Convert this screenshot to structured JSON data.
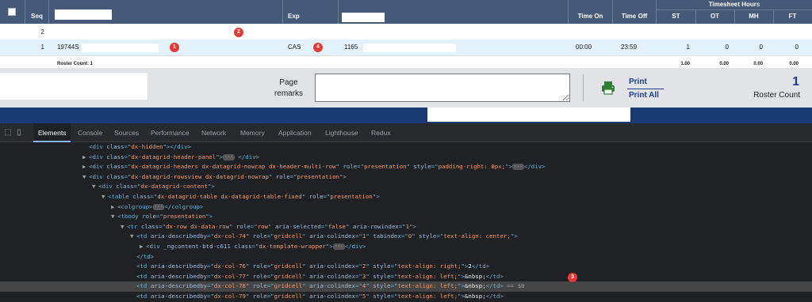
{
  "grid": {
    "headers": {
      "seq": "Seq",
      "exp": "Exp",
      "time_on": "Time On",
      "time_off": "Time Off",
      "timesheet_hours": "Timesheet Hours",
      "st": "ST",
      "ot": "OT",
      "mh": "MH",
      "ft": "FT"
    },
    "rows": [
      {
        "seq": "2",
        "name": "",
        "exp": "",
        "num": "",
        "time_on": "",
        "time_off": "",
        "st": "",
        "ot": "",
        "mh": "",
        "ft": "",
        "marker": "2"
      },
      {
        "seq": "1",
        "name": "19744S",
        "exp": "CAS",
        "num": "1165",
        "time_on": "00:00",
        "time_off": "23:59",
        "st": "1",
        "ot": "0",
        "mh": "0",
        "ft": "0",
        "marker_name": "1",
        "marker_exp": "4"
      }
    ],
    "summary": {
      "roster_count_label": "Roster Count: 1",
      "st_total": "1.00",
      "ot_total": "0.00",
      "mh_total": "0.00",
      "ft_total": "0.00"
    }
  },
  "footer": {
    "page_remarks_line1": "Page",
    "page_remarks_line2": "remarks",
    "print_label": "Print",
    "print_all_label": "Print All",
    "roster_count_value": "1",
    "roster_count_label": "Roster Count"
  },
  "devtools": {
    "tabs": [
      "Elements",
      "Console",
      "Sources",
      "Performance",
      "Network",
      "Memory",
      "Application",
      "Lighthouse",
      "Redux"
    ],
    "active_tab": "Elements",
    "marker": "3",
    "lines": [
      {
        "indent": 0,
        "arrow": "",
        "parts": [
          [
            "tg",
            "<div "
          ],
          [
            "an",
            "class"
          ],
          [
            "tg",
            "=\""
          ],
          [
            "av",
            "dx-hidden"
          ],
          [
            "tg",
            "\"></div>"
          ]
        ]
      },
      {
        "indent": 0,
        "arrow": "▶",
        "parts": [
          [
            "tg",
            "<div "
          ],
          [
            "an",
            "class"
          ],
          [
            "tg",
            "=\""
          ],
          [
            "av",
            "dx-datagrid-header-panel"
          ],
          [
            "tg",
            "\">"
          ],
          [
            "ell",
            "···"
          ],
          [
            "tg",
            " </div>"
          ]
        ]
      },
      {
        "indent": 0,
        "arrow": "▶",
        "parts": [
          [
            "tg",
            "<div "
          ],
          [
            "an",
            "class"
          ],
          [
            "tg",
            "=\""
          ],
          [
            "av",
            "dx-datagrid-headers dx-datagrid-nowrap dx-header-multi-row"
          ],
          [
            "tg",
            "\" "
          ],
          [
            "an",
            "role"
          ],
          [
            "tg",
            "=\""
          ],
          [
            "av",
            "presentation"
          ],
          [
            "tg",
            "\" "
          ],
          [
            "an",
            "style"
          ],
          [
            "tg",
            "=\""
          ],
          [
            "av",
            "padding-right: 0px;"
          ],
          [
            "tg",
            "\">"
          ],
          [
            "ell",
            "···"
          ],
          [
            "tg",
            "</div>"
          ]
        ]
      },
      {
        "indent": 0,
        "arrow": "▼",
        "parts": [
          [
            "tg",
            "<div "
          ],
          [
            "an",
            "class"
          ],
          [
            "tg",
            "=\""
          ],
          [
            "av",
            "dx-datagrid-rowsview dx-datagrid-nowrap"
          ],
          [
            "tg",
            "\" "
          ],
          [
            "an",
            "role"
          ],
          [
            "tg",
            "=\""
          ],
          [
            "av",
            "presentation"
          ],
          [
            "tg",
            "\">"
          ]
        ]
      },
      {
        "indent": 1,
        "arrow": "▼",
        "parts": [
          [
            "tg",
            "<div "
          ],
          [
            "an",
            "class"
          ],
          [
            "tg",
            "=\""
          ],
          [
            "av",
            "dx-datagrid-content"
          ],
          [
            "tg",
            "\">"
          ]
        ]
      },
      {
        "indent": 2,
        "arrow": "▼",
        "parts": [
          [
            "tg",
            "<table "
          ],
          [
            "an",
            "class"
          ],
          [
            "tg",
            "=\""
          ],
          [
            "av",
            "dx-datagrid-table dx-datagrid-table-fixed"
          ],
          [
            "tg",
            "\" "
          ],
          [
            "an",
            "role"
          ],
          [
            "tg",
            "=\""
          ],
          [
            "av",
            "presentation"
          ],
          [
            "tg",
            "\">"
          ]
        ]
      },
      {
        "indent": 3,
        "arrow": "▶",
        "parts": [
          [
            "tg",
            "<colgroup>"
          ],
          [
            "ell",
            "···"
          ],
          [
            "tg",
            "</colgroup>"
          ]
        ]
      },
      {
        "indent": 3,
        "arrow": "▼",
        "parts": [
          [
            "tg",
            "<tbody "
          ],
          [
            "an",
            "role"
          ],
          [
            "tg",
            "=\""
          ],
          [
            "av",
            "presentation"
          ],
          [
            "tg",
            "\">"
          ]
        ]
      },
      {
        "indent": 4,
        "arrow": "▼",
        "parts": [
          [
            "tg",
            "<tr "
          ],
          [
            "an",
            "class"
          ],
          [
            "tg",
            "=\""
          ],
          [
            "av",
            "dx-row dx-data-row"
          ],
          [
            "tg",
            "\" "
          ],
          [
            "an",
            "role"
          ],
          [
            "tg",
            "=\""
          ],
          [
            "av",
            "row"
          ],
          [
            "tg",
            "\" "
          ],
          [
            "an",
            "aria-selected"
          ],
          [
            "tg",
            "=\""
          ],
          [
            "av",
            "false"
          ],
          [
            "tg",
            "\" "
          ],
          [
            "an",
            "aria-rowindex"
          ],
          [
            "tg",
            "=\""
          ],
          [
            "av",
            "1"
          ],
          [
            "tg",
            "\">"
          ]
        ]
      },
      {
        "indent": 5,
        "arrow": "▼",
        "parts": [
          [
            "tg",
            "<td "
          ],
          [
            "an",
            "aria-describedby"
          ],
          [
            "tg",
            "=\""
          ],
          [
            "av",
            "dx-col-74"
          ],
          [
            "tg",
            "\" "
          ],
          [
            "an",
            "role"
          ],
          [
            "tg",
            "=\""
          ],
          [
            "av",
            "gridcell"
          ],
          [
            "tg",
            "\" "
          ],
          [
            "an",
            "aria-colindex"
          ],
          [
            "tg",
            "=\""
          ],
          [
            "av",
            "1"
          ],
          [
            "tg",
            "\" "
          ],
          [
            "an",
            "tabindex"
          ],
          [
            "tg",
            "=\""
          ],
          [
            "av",
            "0"
          ],
          [
            "tg",
            "\" "
          ],
          [
            "an",
            "style"
          ],
          [
            "tg",
            "=\""
          ],
          [
            "av",
            "text-align: center;"
          ],
          [
            "tg",
            "\">"
          ]
        ]
      },
      {
        "indent": 6,
        "arrow": "▶",
        "parts": [
          [
            "tg",
            "<div "
          ],
          [
            "an",
            "_ngcontent-btd-c611"
          ],
          [
            "tg",
            " "
          ],
          [
            "an",
            "class"
          ],
          [
            "tg",
            "=\""
          ],
          [
            "av",
            "dx-template-wrapper"
          ],
          [
            "tg",
            "\">"
          ],
          [
            "ell",
            "···"
          ],
          [
            "tg",
            "</div>"
          ]
        ]
      },
      {
        "indent": 5,
        "arrow": "",
        "parts": [
          [
            "tg",
            "</td>"
          ]
        ]
      },
      {
        "indent": 5,
        "arrow": "",
        "parts": [
          [
            "tg",
            "<td "
          ],
          [
            "an",
            "aria-describedby"
          ],
          [
            "tg",
            "=\""
          ],
          [
            "av",
            "dx-col-76"
          ],
          [
            "tg",
            "\" "
          ],
          [
            "an",
            "role"
          ],
          [
            "tg",
            "=\""
          ],
          [
            "av",
            "gridcell"
          ],
          [
            "tg",
            "\" "
          ],
          [
            "an",
            "aria-colindex"
          ],
          [
            "tg",
            "=\""
          ],
          [
            "av",
            "2"
          ],
          [
            "tg",
            "\" "
          ],
          [
            "an",
            "style"
          ],
          [
            "tg",
            "=\""
          ],
          [
            "av",
            "text-align: right;"
          ],
          [
            "tg",
            "\">"
          ],
          [
            "tx",
            "2"
          ],
          [
            "tg",
            "</td>"
          ]
        ]
      },
      {
        "indent": 5,
        "arrow": "",
        "parts": [
          [
            "tg",
            "<td "
          ],
          [
            "an",
            "aria-describedby"
          ],
          [
            "tg",
            "=\""
          ],
          [
            "av",
            "dx-col-77"
          ],
          [
            "tg",
            "\" "
          ],
          [
            "an",
            "role"
          ],
          [
            "tg",
            "=\""
          ],
          [
            "av",
            "gridcell"
          ],
          [
            "tg",
            "\" "
          ],
          [
            "an",
            "aria-colindex"
          ],
          [
            "tg",
            "=\""
          ],
          [
            "av",
            "3"
          ],
          [
            "tg",
            "\" "
          ],
          [
            "an",
            "style"
          ],
          [
            "tg",
            "=\""
          ],
          [
            "av",
            "text-align: left;"
          ],
          [
            "tg",
            "\">"
          ],
          [
            "tx",
            "&nbsp;"
          ],
          [
            "tg",
            "</td>"
          ]
        ]
      },
      {
        "indent": 5,
        "arrow": "",
        "selected": true,
        "parts": [
          [
            "tg",
            "<td "
          ],
          [
            "an",
            "aria-describedby"
          ],
          [
            "tg",
            "=\""
          ],
          [
            "av",
            "dx-col-78"
          ],
          [
            "tg",
            "\" "
          ],
          [
            "an",
            "role"
          ],
          [
            "tg",
            "=\""
          ],
          [
            "av",
            "gridcell"
          ],
          [
            "tg",
            "\" "
          ],
          [
            "an",
            "aria-colindex"
          ],
          [
            "tg",
            "=\""
          ],
          [
            "av",
            "4"
          ],
          [
            "tg",
            "\" "
          ],
          [
            "an",
            "style"
          ],
          [
            "tg",
            "=\""
          ],
          [
            "av",
            "text-align: left;"
          ],
          [
            "tg",
            "\">"
          ],
          [
            "tx",
            "&nbsp;"
          ],
          [
            "tg",
            "</td>"
          ],
          [
            "eq",
            " == $0"
          ]
        ]
      },
      {
        "indent": 5,
        "arrow": "",
        "parts": [
          [
            "tg",
            "<td "
          ],
          [
            "an",
            "aria-describedby"
          ],
          [
            "tg",
            "=\""
          ],
          [
            "av",
            "dx-col-79"
          ],
          [
            "tg",
            "\" "
          ],
          [
            "an",
            "role"
          ],
          [
            "tg",
            "=\""
          ],
          [
            "av",
            "gridcell"
          ],
          [
            "tg",
            "\" "
          ],
          [
            "an",
            "aria-colindex"
          ],
          [
            "tg",
            "=\""
          ],
          [
            "av",
            "5"
          ],
          [
            "tg",
            "\" "
          ],
          [
            "an",
            "style"
          ],
          [
            "tg",
            "=\""
          ],
          [
            "av",
            "text-align: left;"
          ],
          [
            "tg",
            "\">"
          ],
          [
            "tx",
            "&nbsp;"
          ],
          [
            "tg",
            "</td>"
          ]
        ]
      },
      {
        "indent": 5,
        "arrow": "",
        "parts": [
          [
            "tg",
            "<td "
          ],
          [
            "an",
            "aria-describedby"
          ],
          [
            "tg",
            "=\""
          ],
          [
            "av",
            "dx-col-81"
          ],
          [
            "tg",
            "\" "
          ],
          [
            "an",
            "role"
          ],
          [
            "tg",
            "=\""
          ],
          [
            "av",
            "gridcell"
          ],
          [
            "tg",
            "\" "
          ],
          [
            "an",
            "aria-colindex"
          ],
          [
            "tg",
            "=\""
          ],
          [
            "av",
            "6"
          ],
          [
            "tg",
            "\" "
          ],
          [
            "an",
            "style"
          ],
          [
            "tg",
            "=\""
          ],
          [
            "av",
            "text-align: left;"
          ],
          [
            "tg",
            "\">"
          ],
          [
            "tx",
            "&nbsp;"
          ],
          [
            "tg",
            "</td>"
          ]
        ]
      }
    ]
  },
  "colors": {
    "header_bg": "#455a78",
    "selected_row_bg": "#e3f1fa",
    "footer_bg": "#e2e3e6",
    "link_blue": "#1d3d8f",
    "print_icon_green": "#2e7d32",
    "marker_red": "#e53935",
    "devtools_bg": "#202124"
  }
}
